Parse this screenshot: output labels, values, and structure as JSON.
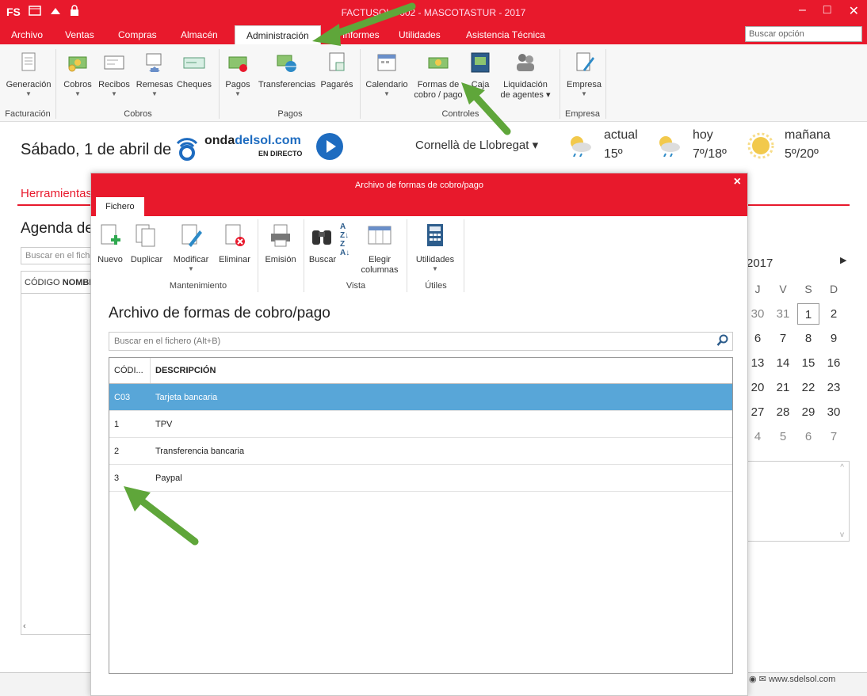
{
  "app": {
    "title": "FACTUSOL - 002 - MASCOTASTUR - 2017",
    "logo_text": "FS",
    "controls": [
      "–",
      "□",
      "✕"
    ]
  },
  "menu": {
    "items": [
      "Archivo",
      "Ventas",
      "Compras",
      "Almacén",
      "Administración",
      "Informes",
      "Utilidades",
      "Asistencia Técnica"
    ],
    "active": "Administración",
    "search_placeholder": "Buscar opción"
  },
  "ribbon": {
    "buttons": {
      "generacion": "Generación",
      "cobros": "Cobros",
      "recibos": "Recibos",
      "remesas": "Remesas",
      "cheques": "Cheques",
      "pagos": "Pagos",
      "transferencias": "Transferencias",
      "pagares": "Pagarés",
      "calendario": "Calendario",
      "formas_l1": "Formas de",
      "formas_l2": "cobro / pago",
      "caja": "Caja",
      "liquidacion_l1": "Liquidación",
      "liquidacion_l2": "de agentes ▾",
      "empresa": "Empresa"
    },
    "groups": {
      "facturacion": "Facturación",
      "cobros": "Cobros",
      "pagos": "Pagos",
      "controles": "Controles",
      "empresa": "Empresa"
    }
  },
  "dashboard": {
    "date": "Sábado, 1 de abril de",
    "radio": {
      "name_a": "onda",
      "name_b": "delsol",
      "name_c": ".com",
      "sub": "EN DIRECTO"
    },
    "city": "Cornellà de Llobregat ▾",
    "weather": [
      {
        "label": "actual",
        "value": "15º"
      },
      {
        "label": "hoy",
        "value": "7º/18º"
      },
      {
        "label": "mañana",
        "value": "5º/20º"
      }
    ],
    "herramientas": "Herramientas",
    "agenda": "Agenda de",
    "search_placeholder": "Buscar en el fichero",
    "col_codigo": "CÓDIGO",
    "col_nombre": "NOMBRE",
    "footer_link": "www.sdelsol.com"
  },
  "calendar": {
    "year": "2017",
    "headers": [
      "J",
      "V",
      "S",
      "D"
    ],
    "weeks": [
      [
        "30",
        "31",
        "1",
        "2"
      ],
      [
        "6",
        "7",
        "8",
        "9"
      ],
      [
        "13",
        "14",
        "15",
        "16"
      ],
      [
        "20",
        "21",
        "22",
        "23"
      ],
      [
        "27",
        "28",
        "29",
        "30"
      ],
      [
        "4",
        "5",
        "6",
        "7"
      ]
    ],
    "today": "1"
  },
  "dialog": {
    "title": "Archivo de formas de cobro/pago",
    "tab": "Fichero",
    "buttons": {
      "nuevo": "Nuevo",
      "duplicar": "Duplicar",
      "modificar": "Modificar",
      "eliminar": "Eliminar",
      "emision": "Emisión",
      "buscar": "Buscar",
      "elegir_l1": "Elegir",
      "elegir_l2": "columnas",
      "utilidades": "Utilidades"
    },
    "groups": {
      "mantenimiento": "Mantenimiento",
      "vista": "Vista",
      "utiles": "Útiles"
    },
    "heading": "Archivo de formas de cobro/pago",
    "search_placeholder": "Buscar en el fichero (Alt+B)",
    "columns": {
      "code": "CÓDI...",
      "desc": "DESCRIPCIÓN"
    },
    "rows": [
      {
        "code": "C03",
        "desc": "Tarjeta bancaria",
        "selected": true
      },
      {
        "code": "1",
        "desc": "TPV",
        "selected": false
      },
      {
        "code": "2",
        "desc": "Transferencia bancaria",
        "selected": false
      },
      {
        "code": "3",
        "desc": "Paypal",
        "selected": false
      }
    ]
  },
  "colors": {
    "brand_red": "#e8192c",
    "selection_blue": "#58a6d8",
    "arrow_green": "#5fa63a"
  }
}
